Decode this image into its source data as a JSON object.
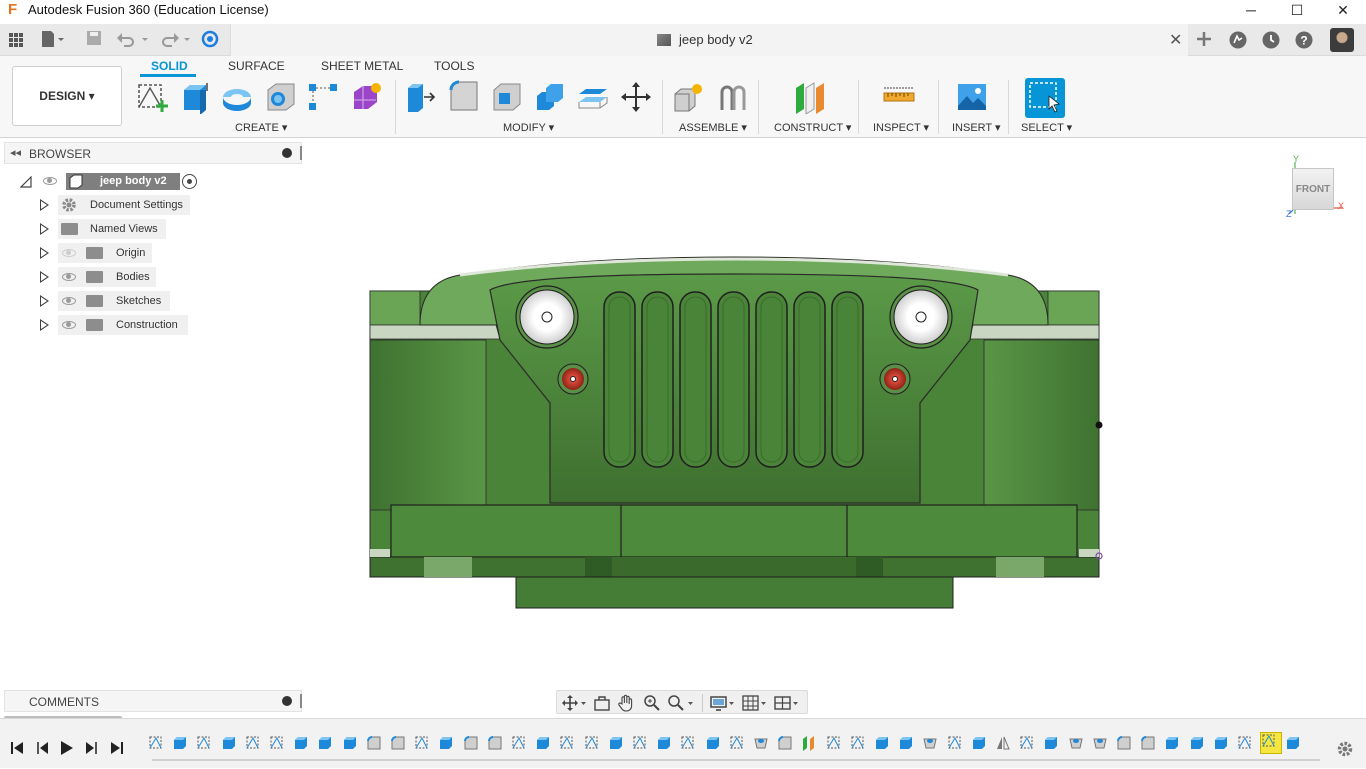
{
  "window": {
    "title": "Autodesk Fusion 360 (Education License)",
    "logo_letter": "F",
    "minimize": "─",
    "maximize": "☐",
    "close": "✕"
  },
  "document": {
    "tab_title": "jeep body v2",
    "tab_close": "✕"
  },
  "ribbon": {
    "workspace": "DESIGN",
    "tabs": [
      "SOLID",
      "SURFACE",
      "SHEET METAL",
      "TOOLS"
    ],
    "groups": {
      "create": "CREATE",
      "modify": "MODIFY",
      "assemble": "ASSEMBLE",
      "construct": "CONSTRUCT",
      "inspect": "INSPECT",
      "insert": "INSERT",
      "select": "SELECT"
    },
    "dropdown_glyph": "▾"
  },
  "browser": {
    "title": "BROWSER",
    "root": "jeep body v2",
    "items": [
      {
        "label": "Document Settings",
        "icon": "gear-icon",
        "visible": true
      },
      {
        "label": "Named Views",
        "icon": "folder-icon",
        "visible": true
      },
      {
        "label": "Origin",
        "icon": "folder-icon",
        "visible": false
      },
      {
        "label": "Bodies",
        "icon": "folder-icon",
        "visible": true
      },
      {
        "label": "Sketches",
        "icon": "folder-icon",
        "visible": true
      },
      {
        "label": "Construction",
        "icon": "folder-icon",
        "visible": true
      }
    ]
  },
  "viewcube": {
    "face": "FRONT",
    "y_axis": "Y",
    "x_axis": "X",
    "z_axis": "Z"
  },
  "comments": {
    "title": "COMMENTS"
  },
  "colors": {
    "accent": "#0696d7",
    "body_green": "#4f8a3c",
    "body_dark": "#3d6e2e",
    "headlight": "#f2f2f2",
    "taillight": "#c0392b",
    "timeline_highlight": "#f5e642"
  },
  "timeline": {
    "feature_count": 48
  }
}
